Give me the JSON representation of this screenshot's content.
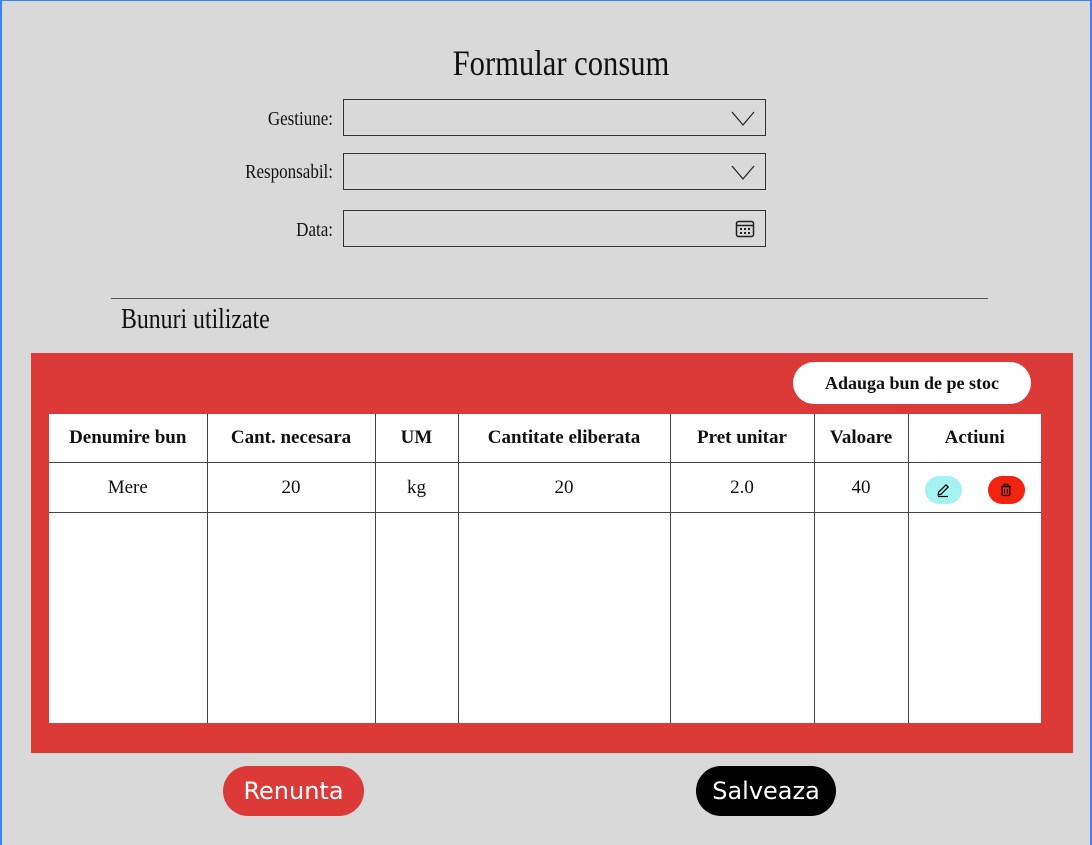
{
  "form": {
    "title": "Formular consum",
    "fields": [
      {
        "label": "Gestiune:",
        "value": "",
        "type": "select"
      },
      {
        "label": "Responsabil:",
        "value": "",
        "type": "select"
      },
      {
        "label": "Data:",
        "value": "",
        "type": "date"
      }
    ]
  },
  "goods": {
    "section_title": "Bunuri utilizate",
    "add_button_label": "Adauga bun de pe stoc",
    "columns": [
      "Denumire bun",
      "Cant. necesara",
      "UM",
      "Cantitate eliberata",
      "Pret unitar",
      "Valoare",
      "Actiuni"
    ],
    "rows": [
      {
        "name": "Mere",
        "qty_needed": "20",
        "um": "kg",
        "qty_released": "20",
        "unit_price": "2.0",
        "value": "40"
      }
    ],
    "row_actions": {
      "edit_icon": "pencil-icon",
      "delete_icon": "trash-icon"
    }
  },
  "footer": {
    "cancel_label": "Renunta",
    "save_label": "Salveaza"
  },
  "colors": {
    "panel": "#dc3a38",
    "edit_button": "#a5f3f0",
    "delete_button": "#f2230f",
    "save_button": "#000000",
    "background": "#d9d9d9"
  }
}
